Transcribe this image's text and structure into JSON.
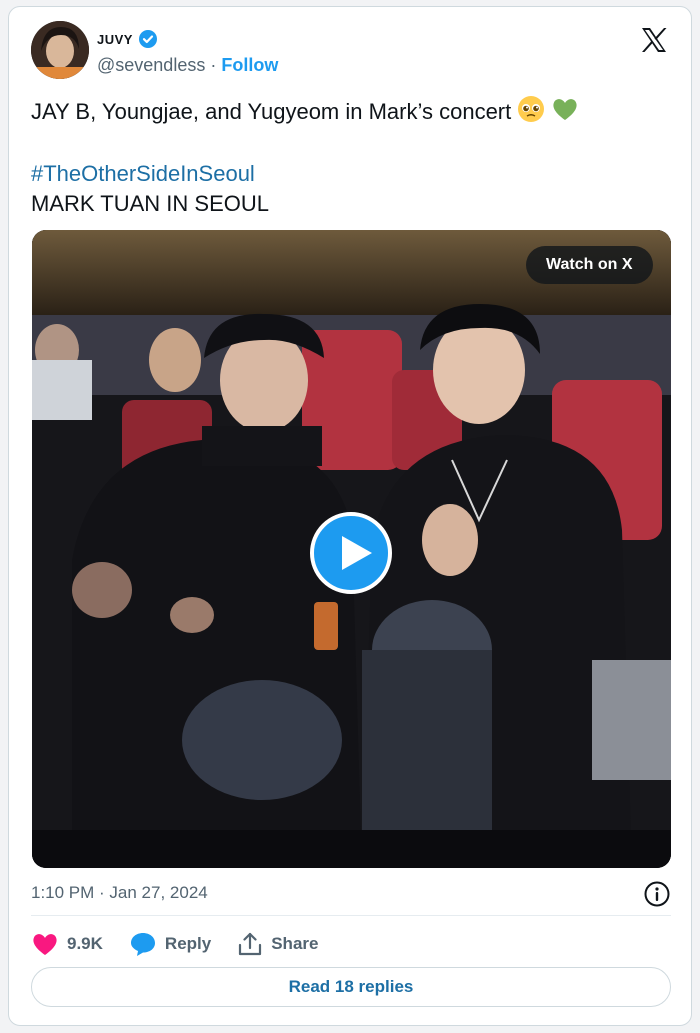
{
  "author": {
    "display_name": "JUVY",
    "handle": "@sevendless",
    "separator": " · ",
    "follow_label": "Follow"
  },
  "tweet": {
    "text": "JAY B, Youngjae, and Yugyeom in Mark’s concert ",
    "emojis": [
      "pleading-face-emoji",
      "green-heart-emoji"
    ],
    "hashtag": "#TheOtherSideInSeoul",
    "second_line": "MARK TUAN IN SEOUL"
  },
  "media": {
    "watch_label": "Watch on X"
  },
  "meta": {
    "timestamp": "1:10 PM · Jan 27, 2024"
  },
  "actions": {
    "like_count": "9.9K",
    "reply_label": "Reply",
    "share_label": "Share"
  },
  "read_replies_label": "Read 18 replies",
  "colors": {
    "accent": "#1d9bf0",
    "link": "#1d6fa5",
    "heart": "#f91880",
    "muted": "#536471"
  }
}
